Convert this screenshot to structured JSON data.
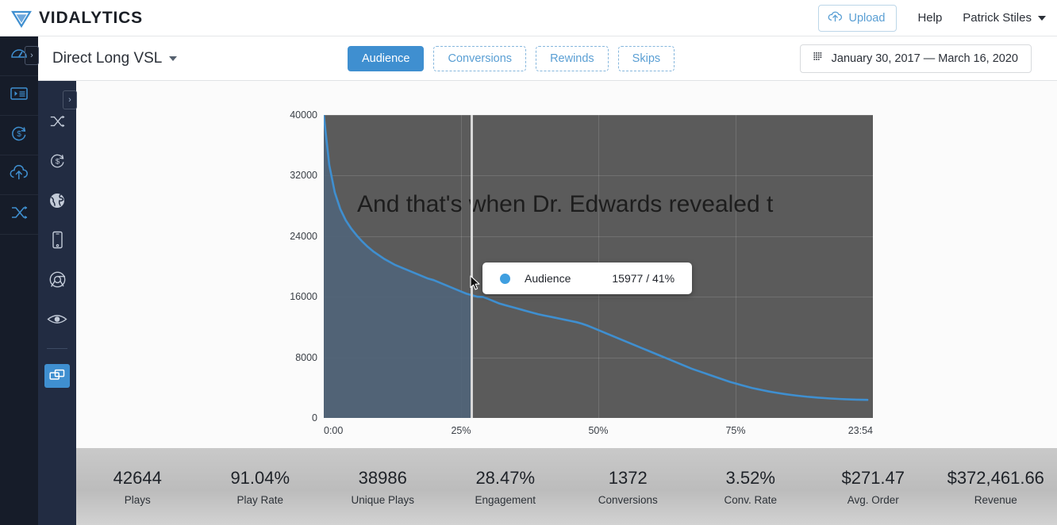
{
  "brand": {
    "name": "VIDALYTICS",
    "logo_icon": "triangle-v-logo-icon"
  },
  "topbar": {
    "upload_label": "Upload",
    "upload_icon": "cloud-upload-icon",
    "help_label": "Help",
    "user_name": "Patrick Stiles",
    "user_caret_icon": "caret-down-icon"
  },
  "rail_primary": {
    "items": [
      {
        "icon": "dashboard-gauge-icon",
        "name": "dashboard"
      },
      {
        "icon": "video-playlist-icon",
        "name": "videos"
      },
      {
        "icon": "dollar-refresh-icon",
        "name": "revenue"
      },
      {
        "icon": "cloud-upload-icon",
        "name": "upload"
      },
      {
        "icon": "shuffle-icon",
        "name": "split-test"
      }
    ],
    "expand_icon": "chevron-right-icon"
  },
  "rail_secondary": {
    "items": [
      {
        "icon": "shuffle-icon",
        "name": "split-test",
        "active": false
      },
      {
        "icon": "dollar-refresh-icon",
        "name": "revenue",
        "active": false
      },
      {
        "icon": "globe-icon",
        "name": "geography",
        "active": false
      },
      {
        "icon": "mobile-device-icon",
        "name": "devices",
        "active": false
      },
      {
        "icon": "browser-chrome-icon",
        "name": "browsers",
        "active": false
      },
      {
        "icon": "eye-icon",
        "name": "visibility",
        "active": false
      }
    ],
    "active_item": {
      "icon": "copy-layers-icon",
      "name": "compare"
    },
    "expand_icon": "chevron-right-icon"
  },
  "subheader": {
    "video_title": "Direct Long VSL",
    "video_title_caret_icon": "chevron-down-icon",
    "tabs": [
      {
        "label": "Audience",
        "active": true
      },
      {
        "label": "Conversions",
        "active": false
      },
      {
        "label": "Rewinds",
        "active": false
      },
      {
        "label": "Skips",
        "active": false
      }
    ],
    "date_range": "January 30, 2017 — March 16, 2020",
    "date_range_icon": "calendar-grid-icon"
  },
  "tooltip": {
    "series_label": "Audience",
    "value": "15977 / 41%",
    "dot_color": "#3f9fe0"
  },
  "video_caption": "And that's when Dr. Edwards revealed t",
  "colors": {
    "accent": "#3f8fd0",
    "line": "#3f8fd0",
    "plot_bg": "#5b5b5b",
    "fill_left": "#506478",
    "rail_primary_bg": "#161c29",
    "rail_secondary_bg": "#222c42"
  },
  "chart_data": {
    "type": "area",
    "title": "",
    "xlabel": "",
    "ylabel": "",
    "series": [
      {
        "name": "Audience",
        "values": [
          40000,
          33400,
          29800,
          27600,
          26100,
          25000,
          24100,
          23300,
          22600,
          22000,
          21500,
          21000,
          20600,
          20200,
          19900,
          19600,
          19300,
          19000,
          18700,
          18400,
          18200,
          17900,
          17600,
          17300,
          17000,
          16700,
          16400,
          16200,
          16000,
          15977,
          15700,
          15400,
          15100,
          14900,
          14700,
          14500,
          14300,
          14100,
          13900,
          13700,
          13550,
          13400,
          13250,
          13100,
          12950,
          12800,
          12650,
          12450,
          12200,
          11900,
          11600,
          11300,
          11000,
          10700,
          10400,
          10100,
          9800,
          9500,
          9200,
          8900,
          8600,
          8300,
          8000,
          7700,
          7400,
          7100,
          6800,
          6500,
          6250,
          6000,
          5750,
          5500,
          5250,
          5000,
          4750,
          4550,
          4350,
          4150,
          3950,
          3800,
          3650,
          3500,
          3380,
          3260,
          3150,
          3050,
          2960,
          2880,
          2800,
          2740,
          2680,
          2630,
          2580,
          2540,
          2500,
          2470,
          2440,
          2420,
          2400,
          2390,
          2380,
          1800
        ]
      }
    ],
    "x": [
      0,
      1,
      2,
      3,
      4,
      5,
      6,
      7,
      8,
      9,
      10,
      11,
      12,
      13,
      14,
      15,
      16,
      17,
      18,
      19,
      20,
      21,
      22,
      23,
      24,
      25,
      26,
      27,
      28,
      29,
      30,
      31,
      32,
      33,
      34,
      35,
      36,
      37,
      38,
      39,
      40,
      41,
      42,
      43,
      44,
      45,
      46,
      47,
      48,
      49,
      50,
      51,
      52,
      53,
      54,
      55,
      56,
      57,
      58,
      59,
      60,
      61,
      62,
      63,
      64,
      65,
      66,
      67,
      68,
      69,
      70,
      71,
      72,
      73,
      74,
      75,
      76,
      77,
      78,
      79,
      80,
      81,
      82,
      83,
      84,
      85,
      86,
      87,
      88,
      89,
      90,
      91,
      92,
      93,
      94,
      95,
      96,
      97,
      98,
      99
    ],
    "yticks": [
      0,
      8000,
      16000,
      24000,
      32000,
      40000
    ],
    "ylim": [
      0,
      40000
    ],
    "xlim": [
      0,
      100
    ],
    "xtick_positions": [
      0,
      25,
      50,
      75,
      100
    ],
    "xtick_labels": [
      "0:00",
      "25%",
      "50%",
      "75%",
      "23:54"
    ],
    "grid": true,
    "legend": "none",
    "cursor_x_percent": 27,
    "cursor_value": 15977,
    "cursor_percent_label": "41%"
  },
  "stats": [
    {
      "value": "42644",
      "label": "Plays"
    },
    {
      "value": "91.04%",
      "label": "Play Rate"
    },
    {
      "value": "38986",
      "label": "Unique Plays"
    },
    {
      "value": "28.47%",
      "label": "Engagement"
    },
    {
      "value": "1372",
      "label": "Conversions"
    },
    {
      "value": "3.52%",
      "label": "Conv. Rate"
    },
    {
      "value": "$271.47",
      "label": "Avg. Order"
    },
    {
      "value": "$372,461.66",
      "label": "Revenue"
    }
  ]
}
